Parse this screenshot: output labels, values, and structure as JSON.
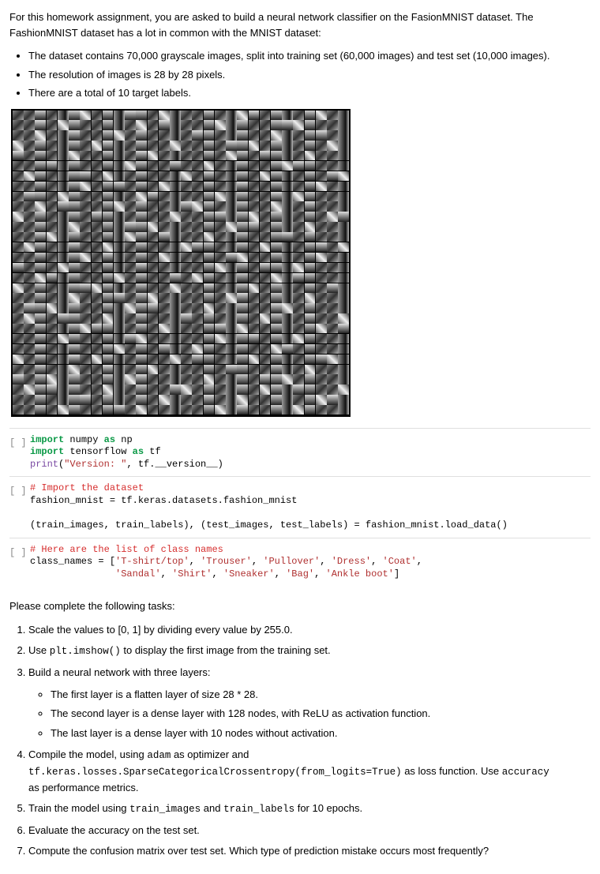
{
  "intro": {
    "p1": "For this homework assignment, you are asked to build a neural network classifier on the FasionMNIST dataset. The FashionMNIST dataset has a lot in common with the MNIST dataset:"
  },
  "bullets": [
    "The dataset contains 70,000 grayscale images, split into training set (60,000 images) and test set (10,000 images).",
    "The resolution of images is 28 by 28 pixels.",
    "There are a total of 10 target labels."
  ],
  "cellPrompt": "[ ]",
  "code1": {
    "l1a": "import",
    "l1b": " numpy ",
    "l1c": "as",
    "l1d": " np",
    "l2a": "import",
    "l2b": " tensorflow ",
    "l2c": "as",
    "l2d": " tf",
    "l3a": "print",
    "l3b": "(",
    "l3c": "\"Version: \"",
    "l3d": ", tf.__version__)"
  },
  "code2": {
    "l1": "# Import the dataset",
    "l2": "fashion_mnist = tf.keras.datasets.fashion_mnist",
    "blank": "",
    "l3": "(train_images, train_labels), (test_images, test_labels) = fashion_mnist.load_data()"
  },
  "code3": {
    "l1": "# Here are the list of class names",
    "l2a": "class_names = [",
    "l2b": "'T-shirt/top'",
    "l2c": ", ",
    "l2d": "'Trouser'",
    "l2e": ", ",
    "l2f": "'Pullover'",
    "l2g": ", ",
    "l2h": "'Dress'",
    "l2i": ", ",
    "l2j": "'Coat'",
    "l2k": ",",
    "l3pad": "               ",
    "l3a": "'Sandal'",
    "l3b": ", ",
    "l3c": "'Shirt'",
    "l3d": ", ",
    "l3e": "'Sneaker'",
    "l3f": ", ",
    "l3g": "'Bag'",
    "l3h": ", ",
    "l3i": "'Ankle boot'",
    "l3j": "]"
  },
  "tasksHeading": "Please complete the following tasks:",
  "tasks": {
    "t1": "Scale the values to [0, 1] by dividing every value by 255.0.",
    "t2a": "Use ",
    "t2code": "plt.imshow()",
    "t2b": " to display the first image from the training set.",
    "t3": "Build a neural network with three layers:",
    "t3sub": [
      "The first layer is a flatten layer of size 28 * 28.",
      "The second layer is a dense layer with 128 nodes, with ReLU as activation function.",
      "The last layer is a dense layer with 10 nodes without activation."
    ],
    "t4a": "Compile the model, using ",
    "t4b": "adam",
    "t4c": " as optimizer and ",
    "t4d": "tf.keras.losses.SparseCategoricalCrossentropy(from_logits=True)",
    "t4e": " as loss function. Use ",
    "t4f": "accuracy",
    "t4g": " as performance metrics.",
    "t5a": "Train the model using ",
    "t5b": "train_images",
    "t5c": " and ",
    "t5d": "train_labels",
    "t5e": " for 10 epochs.",
    "t6": "Evaluate the accuracy on the test set.",
    "t7": "Compute the confusion matrix over test set. Which type of prediction mistake occurs most frequently?"
  }
}
